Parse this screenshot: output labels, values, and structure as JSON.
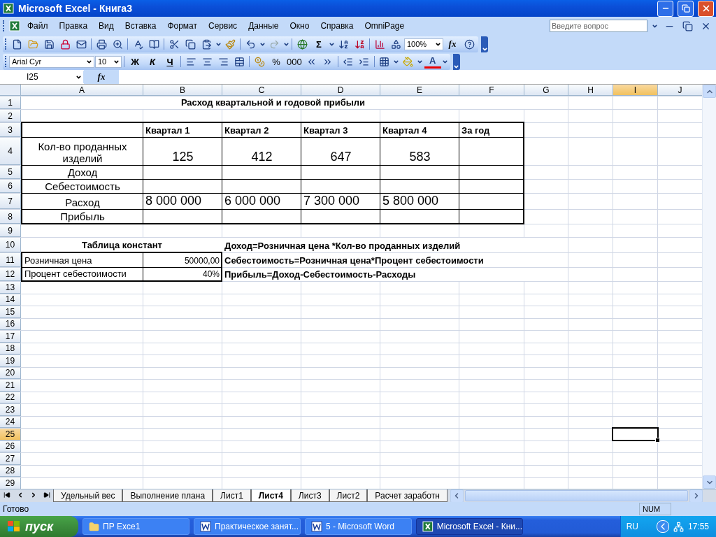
{
  "window": {
    "title": "Microsoft Excel - Книга3"
  },
  "menu": {
    "items": [
      "Файл",
      "Правка",
      "Вид",
      "Вставка",
      "Формат",
      "Сервис",
      "Данные",
      "Окно",
      "Справка",
      "OmniPage"
    ],
    "help_placeholder": "Введите вопрос"
  },
  "standard_toolbar": {
    "sum": "Σ",
    "zoom": "100%",
    "fx": "fx"
  },
  "format_toolbar": {
    "font": "Arial Cyr",
    "size": "10",
    "bold": "Ж",
    "italic": "К",
    "underline": "Ч",
    "percent": "%",
    "thousands": "000",
    "font_color": "A"
  },
  "formula_bar": {
    "name_box": "I25",
    "fx": "fx"
  },
  "columns": [
    {
      "label": "A",
      "selected": false
    },
    {
      "label": "B",
      "selected": false
    },
    {
      "label": "C",
      "selected": false
    },
    {
      "label": "D",
      "selected": false
    },
    {
      "label": "E",
      "selected": false
    },
    {
      "label": "F",
      "selected": false
    },
    {
      "label": "G",
      "selected": false
    },
    {
      "label": "H",
      "selected": false
    },
    {
      "label": "I",
      "selected": true
    },
    {
      "label": "J",
      "selected": false
    }
  ],
  "rows": [
    {
      "number": "1",
      "selected": false,
      "cells": [
        {
          "text": "Расход квартальной и годовой прибыли",
          "kind": "title"
        }
      ]
    },
    {
      "number": "2",
      "selected": false
    },
    {
      "number": "3",
      "selected": false,
      "cells": [
        null,
        {
          "text": "Квартал 1",
          "kind": "header"
        },
        {
          "text": "Квартал 2",
          "kind": "header"
        },
        {
          "text": "Квартал 3",
          "kind": "header"
        },
        {
          "text": "Квартал 4",
          "kind": "header"
        },
        {
          "text": "За год",
          "kind": "header"
        }
      ]
    },
    {
      "number": "4",
      "selected": false,
      "cells": [
        {
          "text": "Кол-во проданных изделий",
          "kind": "label"
        },
        {
          "text": "125",
          "kind": "big"
        },
        {
          "text": "412",
          "kind": "big"
        },
        {
          "text": "647",
          "kind": "big"
        },
        {
          "text": "583",
          "kind": "big"
        }
      ]
    },
    {
      "number": "5",
      "selected": false,
      "cells": [
        {
          "text": "Доход",
          "kind": "label"
        }
      ]
    },
    {
      "number": "6",
      "selected": false,
      "cells": [
        {
          "text": "Себестоимость",
          "kind": "label"
        }
      ]
    },
    {
      "number": "7",
      "selected": false,
      "cells": [
        {
          "text": "Расход",
          "kind": "label"
        },
        {
          "text": "8 000 000",
          "kind": "amount"
        },
        {
          "text": "6 000 000",
          "kind": "amount"
        },
        {
          "text": "7 300 000",
          "kind": "amount"
        },
        {
          "text": "5 800 000",
          "kind": "amount"
        }
      ]
    },
    {
      "number": "8",
      "selected": false,
      "cells": [
        {
          "text": "Прибыль",
          "kind": "label"
        }
      ]
    },
    {
      "number": "9",
      "selected": false
    },
    {
      "number": "10",
      "selected": false,
      "cells": [
        {
          "text": "Таблица констант",
          "kind": "title"
        },
        null,
        {
          "text": "Доход=Розничная цена *Кол-во проданных изделий",
          "kind": "formula"
        }
      ]
    },
    {
      "number": "11",
      "selected": false,
      "cells": [
        {
          "text": "Розничная цена",
          "kind": "plain"
        },
        {
          "text": "50000,00",
          "kind": "right"
        },
        {
          "text": "Себестоимость=Розничная цена*Процент себестоимости",
          "kind": "formula"
        }
      ]
    },
    {
      "number": "12",
      "selected": false,
      "cells": [
        {
          "text": "Процент себестоимости",
          "kind": "plain"
        },
        {
          "text": "40%",
          "kind": "right"
        },
        {
          "text": "Прибыль=Доход-Себестоимость-Расходы",
          "kind": "formula"
        }
      ]
    },
    {
      "number": "13",
      "selected": false
    },
    {
      "number": "14",
      "selected": false
    },
    {
      "number": "15",
      "selected": false
    },
    {
      "number": "16",
      "selected": false
    },
    {
      "number": "17",
      "selected": false
    },
    {
      "number": "18",
      "selected": false
    },
    {
      "number": "19",
      "selected": false
    },
    {
      "number": "20",
      "selected": false
    },
    {
      "number": "21",
      "selected": false
    },
    {
      "number": "22",
      "selected": false
    },
    {
      "number": "23",
      "selected": false
    },
    {
      "number": "24",
      "selected": false
    },
    {
      "number": "25",
      "selected": true
    },
    {
      "number": "26",
      "selected": false
    },
    {
      "number": "27",
      "selected": false
    },
    {
      "number": "28",
      "selected": false
    },
    {
      "number": "29",
      "selected": false
    }
  ],
  "sheet_tabs": [
    {
      "label": "Удельный вес",
      "selected": false
    },
    {
      "label": "Выполнение плана",
      "selected": false
    },
    {
      "label": "Лист1",
      "selected": false
    },
    {
      "label": "Лист4",
      "selected": true
    },
    {
      "label": "Лист3",
      "selected": false
    },
    {
      "label": "Лист2",
      "selected": false
    },
    {
      "label": "Расчет заработн",
      "selected": false
    }
  ],
  "status_bar": {
    "status": "Готово",
    "num": "NUM"
  },
  "taskbar": {
    "start": "пуск",
    "items": [
      {
        "label": "ПР Exce1",
        "kind": "folder",
        "selected": false
      },
      {
        "label": "Практическое занят...",
        "kind": "word",
        "selected": false
      },
      {
        "label": "5 - Microsoft Word",
        "kind": "word",
        "selected": false
      },
      {
        "label": "Microsoft Excel - Кни...",
        "kind": "excel",
        "selected": true
      }
    ],
    "language": "RU",
    "time": "17:55"
  }
}
